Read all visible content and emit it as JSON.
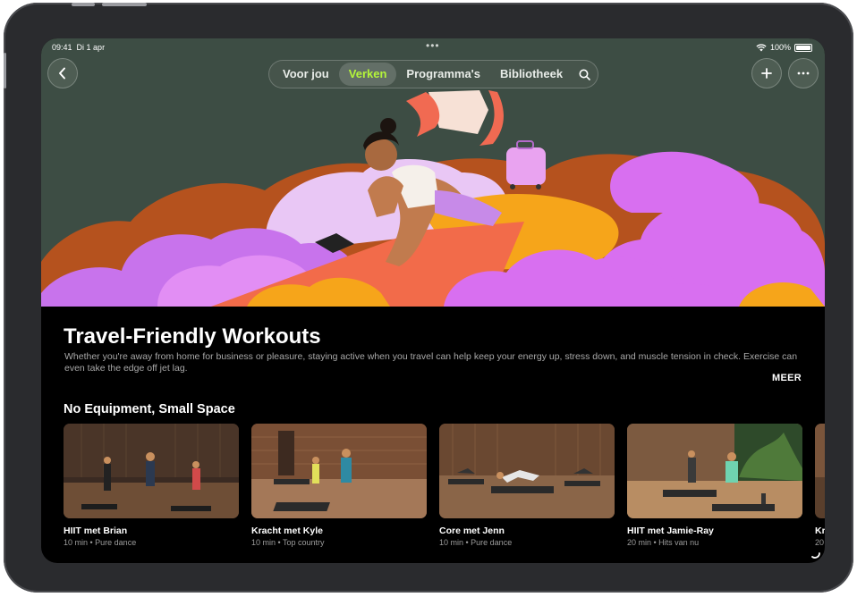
{
  "status": {
    "time": "09:41",
    "date": "Di 1 apr",
    "battery": "100%"
  },
  "nav": {
    "tabs": [
      {
        "label": "Voor jou"
      },
      {
        "label": "Verken"
      },
      {
        "label": "Programma's"
      },
      {
        "label": "Bibliotheek"
      }
    ],
    "active_tab": "Verken",
    "accent_color": "#b4f53a"
  },
  "icons": {
    "back": "chevron-left-icon",
    "search": "search-icon",
    "add": "plus-icon",
    "more": "ellipsis-icon"
  },
  "hero": {
    "title": "Travel-Friendly Workouts",
    "description": "Whether you're away from home for business or pleasure, staying active when you travel can help keep your energy up, stress down, and muscle tension in check. Exercise can even take the edge off jet lag.",
    "more_label": "MEER"
  },
  "section": {
    "title": "No Equipment, Small Space",
    "items": [
      {
        "title": "HIIT met Brian",
        "subtitle": "10 min • Pure dance"
      },
      {
        "title": "Kracht met Kyle",
        "subtitle": "10 min • Top country"
      },
      {
        "title": "Core met Jenn",
        "subtitle": "10 min • Pure dance"
      },
      {
        "title": "HIIT met Jamie-Ray",
        "subtitle": "20 min • Hits van nu"
      },
      {
        "title": "Kr",
        "subtitle": "20"
      }
    ]
  }
}
